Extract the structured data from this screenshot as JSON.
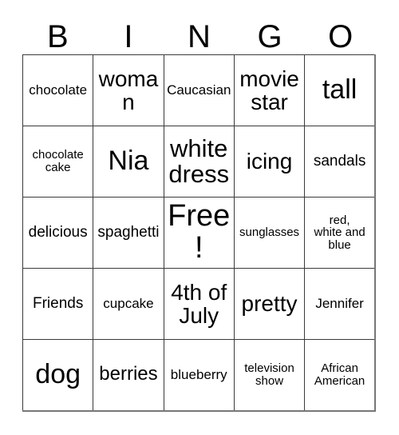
{
  "card": {
    "headers": [
      "B",
      "I",
      "N",
      "G",
      "O"
    ],
    "rows": [
      [
        {
          "text": "chocolate",
          "size": "fs-m"
        },
        {
          "text": "woman",
          "size": "fs-xxl"
        },
        {
          "text": "Caucasian",
          "size": "fs-m"
        },
        {
          "text": "movie\nstar",
          "size": "fs-xxl"
        },
        {
          "text": "tall",
          "size": "fs-mega"
        }
      ],
      [
        {
          "text": "chocolate\ncake",
          "size": "fs-s"
        },
        {
          "text": "Nia",
          "size": "fs-mega"
        },
        {
          "text": "white\ndress",
          "size": "fs-huge"
        },
        {
          "text": "icing",
          "size": "fs-xxl"
        },
        {
          "text": "sandals",
          "size": "fs-l"
        }
      ],
      [
        {
          "text": "delicious",
          "size": "fs-l"
        },
        {
          "text": "spaghetti",
          "size": "fs-l"
        },
        {
          "text": "Free!",
          "size": "fs-free"
        },
        {
          "text": "sunglasses",
          "size": "fs-s"
        },
        {
          "text": "red,\nwhite and\nblue",
          "size": "fs-s"
        }
      ],
      [
        {
          "text": "Friends",
          "size": "fs-l"
        },
        {
          "text": "cupcake",
          "size": "fs-m"
        },
        {
          "text": "4th of\nJuly",
          "size": "fs-xxl"
        },
        {
          "text": "pretty",
          "size": "fs-xxl"
        },
        {
          "text": "Jennifer",
          "size": "fs-m"
        }
      ],
      [
        {
          "text": "dog",
          "size": "fs-mega"
        },
        {
          "text": "berries",
          "size": "fs-xl"
        },
        {
          "text": "blueberry",
          "size": "fs-m"
        },
        {
          "text": "television\nshow",
          "size": "fs-s"
        },
        {
          "text": "African\nAmerican",
          "size": "fs-s"
        }
      ]
    ]
  },
  "colors": {
    "border": "#3a3a3a",
    "outer_border": "#777777",
    "text": "#000000",
    "background": "#ffffff"
  }
}
